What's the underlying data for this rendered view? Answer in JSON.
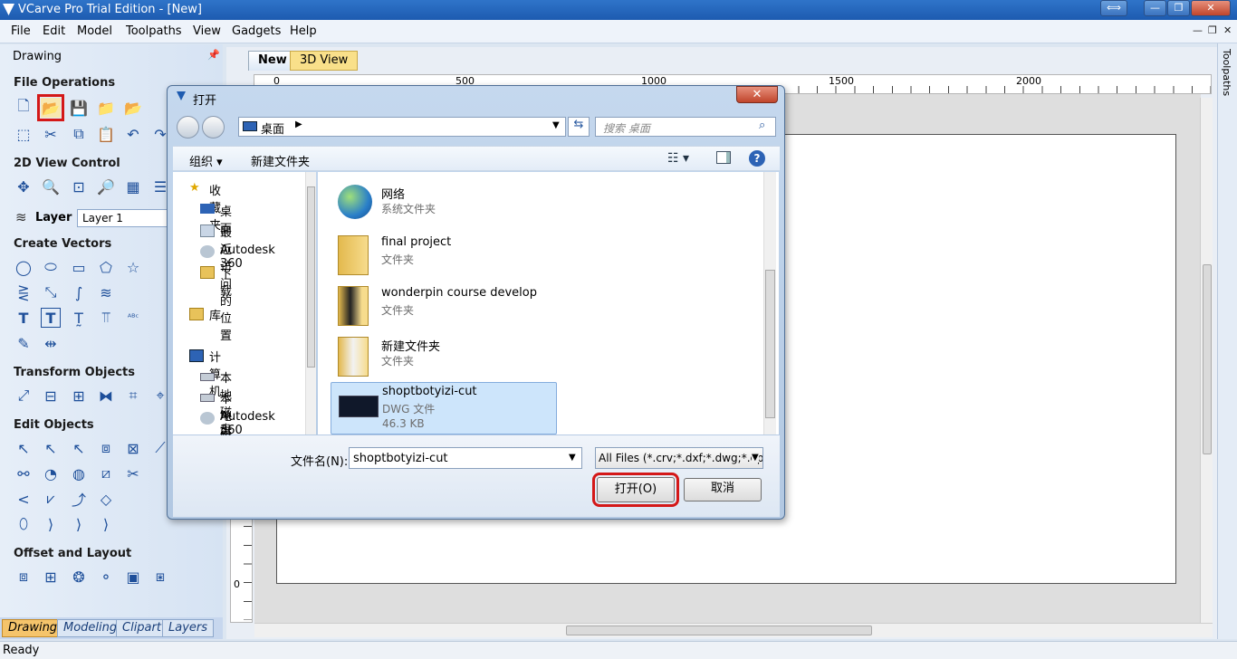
{
  "window": {
    "title": "VCarve Pro Trial Edition - [New]",
    "restore_glyph": "⟺",
    "min_glyph": "—",
    "max_glyph": "❐",
    "close_glyph": "✕"
  },
  "menu": {
    "items": [
      "File",
      "Edit",
      "Model",
      "Toolpaths",
      "View",
      "Gadgets",
      "Help"
    ],
    "mdi_min": "—",
    "mdi_restore": "❐",
    "mdi_close": "✕"
  },
  "panel": {
    "header": "Drawing",
    "sections": {
      "file_operations": "File Operations",
      "view_control": "2D View Control",
      "create_vectors": "Create Vectors",
      "transform": "Transform Objects",
      "edit": "Edit Objects",
      "offset_layout": "Offset and Layout"
    },
    "layer_label": "Layer",
    "layer_value": "Layer 1",
    "bottom_tabs": [
      "Drawing",
      "Modeling",
      "Clipart",
      "Layers"
    ]
  },
  "tabs": {
    "new": "New",
    "view3d": "3D View"
  },
  "ruler": {
    "top_labels": [
      "0",
      "500",
      "1000",
      "1500",
      "2000"
    ],
    "left_label": "0"
  },
  "right_strip": {
    "label": "Toolpaths"
  },
  "status": {
    "text": "Ready"
  },
  "dialog": {
    "title": "打开",
    "close_glyph": "✕",
    "address": "桌面",
    "search_placeholder": "搜索 桌面",
    "toolbar": {
      "organize": "组织 ▾",
      "new_folder": "新建文件夹",
      "help": "?"
    },
    "nav": {
      "favorites": "收藏夹",
      "desktop": "桌面",
      "recent": "最近访问的位置",
      "autodesk1": "Autodesk 360",
      "downloads": "下载",
      "libraries": "库",
      "computer": "计算机",
      "drive_c": "本地磁盘 (C:)",
      "drive_d": "本地磁盘 (D:)",
      "autodesk2": "Autodesk 360"
    },
    "files": [
      {
        "name": "网络",
        "type": "系统文件夹",
        "icon": "network-icon"
      },
      {
        "name": "final project",
        "type": "文件夹",
        "icon": "folder-icon"
      },
      {
        "name": "wonderpin course develop",
        "type": "文件夹",
        "icon": "folder-icon"
      },
      {
        "name": "新建文件夹",
        "type": "文件夹",
        "icon": "folder-icon"
      },
      {
        "name": "shoptbotyizi-cut",
        "type": "DWG 文件",
        "size": "46.3 KB",
        "icon": "dwg-file-icon"
      }
    ],
    "filename_label": "文件名(N):",
    "filename_value": "shoptbotyizi-cut",
    "filter_value": "All Files (*.crv;*.dxf;*.dwg;*.ep",
    "open_button": "打开(O)",
    "cancel_button": "取消"
  },
  "colors": {
    "titlebar": "#1d5bb0",
    "highlight": "#d41818",
    "selection": "#cde5fb"
  }
}
